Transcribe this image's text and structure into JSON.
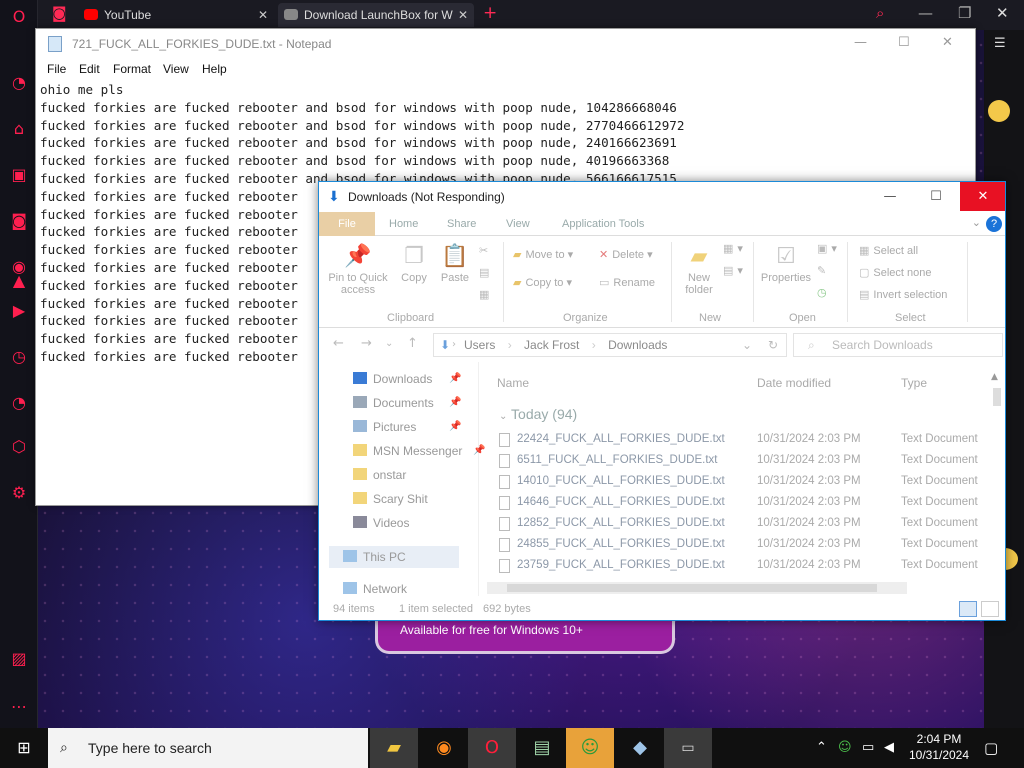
{
  "browser": {
    "tabs": [
      {
        "label": "YouTube"
      },
      {
        "label": "Download LaunchBox for W"
      }
    ],
    "new_tab": "+"
  },
  "promo": {
    "label": "Available for free for Windows 10+"
  },
  "notepad": {
    "title": "721_FUCK_ALL_FORKIES_DUDE.txt - Notepad",
    "menu": [
      "File",
      "Edit",
      "Format",
      "View",
      "Help"
    ],
    "lines": [
      "ohio me pls",
      "fucked forkies are fucked rebooter and bsod for windows with poop nude, 104286668046",
      "fucked forkies are fucked rebooter and bsod for windows with poop nude, 2770466612972",
      "fucked forkies are fucked rebooter and bsod for windows with poop nude, 240166623691",
      "fucked forkies are fucked rebooter and bsod for windows with poop nude, 40196663368",
      "fucked forkies are fucked rebooter and bsod for windows with poop nude, 566166617515",
      "fucked forkies are fucked rebooter",
      "fucked forkies are fucked rebooter",
      "fucked forkies are fucked rebooter",
      "fucked forkies are fucked rebooter",
      "fucked forkies are fucked rebooter",
      "fucked forkies are fucked rebooter",
      "fucked forkies are fucked rebooter",
      "fucked forkies are fucked rebooter",
      "fucked forkies are fucked rebooter",
      "fucked forkies are fucked rebooter"
    ]
  },
  "explorer": {
    "title": "Downloads (Not Responding)",
    "ribbon_tabs": [
      "File",
      "Home",
      "Share",
      "View",
      "Application Tools"
    ],
    "help": "?",
    "clipboard": {
      "pin": "Pin to Quick access",
      "copy": "Copy",
      "paste": "Paste",
      "label": "Clipboard"
    },
    "organize": {
      "move_to": "Move to",
      "copy_to": "Copy to",
      "delete": "Delete",
      "rename": "Rename",
      "label": "Organize"
    },
    "new": {
      "new_folder": "New folder",
      "label": "New"
    },
    "open": {
      "properties": "Properties",
      "label": "Open"
    },
    "select": {
      "select_all": "Select all",
      "select_none": "Select none",
      "invert": "Invert selection",
      "label": "Select"
    },
    "breadcrumb": [
      "Users",
      "Jack Frost",
      "Downloads"
    ],
    "search_placeholder": "Search Downloads",
    "nav": [
      {
        "label": "Downloads",
        "color": "#3a7bd5"
      },
      {
        "label": "Documents",
        "color": "#9aa8b8"
      },
      {
        "label": "Pictures",
        "color": "#9ab8d8"
      },
      {
        "label": "MSN Messenger",
        "color": "#f2d57a"
      },
      {
        "label": "onstar",
        "color": "#f2d57a"
      },
      {
        "label": "Scary Shit",
        "color": "#f2d57a"
      },
      {
        "label": "Videos",
        "color": "#8a8a9a"
      }
    ],
    "this_pc": "This PC",
    "network": "Network",
    "columns": {
      "name": "Name",
      "date": "Date modified",
      "type": "Type"
    },
    "group": "Today (94)",
    "files": [
      {
        "name": "22424_FUCK_ALL_FORKIES_DUDE.txt",
        "date": "10/31/2024 2:03 PM",
        "type": "Text Document"
      },
      {
        "name": "6511_FUCK_ALL_FORKIES_DUDE.txt",
        "date": "10/31/2024 2:03 PM",
        "type": "Text Document"
      },
      {
        "name": "14010_FUCK_ALL_FORKIES_DUDE.txt",
        "date": "10/31/2024 2:03 PM",
        "type": "Text Document"
      },
      {
        "name": "14646_FUCK_ALL_FORKIES_DUDE.txt",
        "date": "10/31/2024 2:03 PM",
        "type": "Text Document"
      },
      {
        "name": "12852_FUCK_ALL_FORKIES_DUDE.txt",
        "date": "10/31/2024 2:03 PM",
        "type": "Text Document"
      },
      {
        "name": "24855_FUCK_ALL_FORKIES_DUDE.txt",
        "date": "10/31/2024 2:03 PM",
        "type": "Text Document"
      },
      {
        "name": "23759_FUCK_ALL_FORKIES_DUDE.txt",
        "date": "10/31/2024 2:03 PM",
        "type": "Text Document"
      }
    ],
    "status": {
      "items": "94 items",
      "selected": "1 item selected",
      "size": "692 bytes"
    }
  },
  "taskbar": {
    "search_placeholder": "Type here to search",
    "time": "2:04 PM",
    "date": "10/31/2024"
  }
}
